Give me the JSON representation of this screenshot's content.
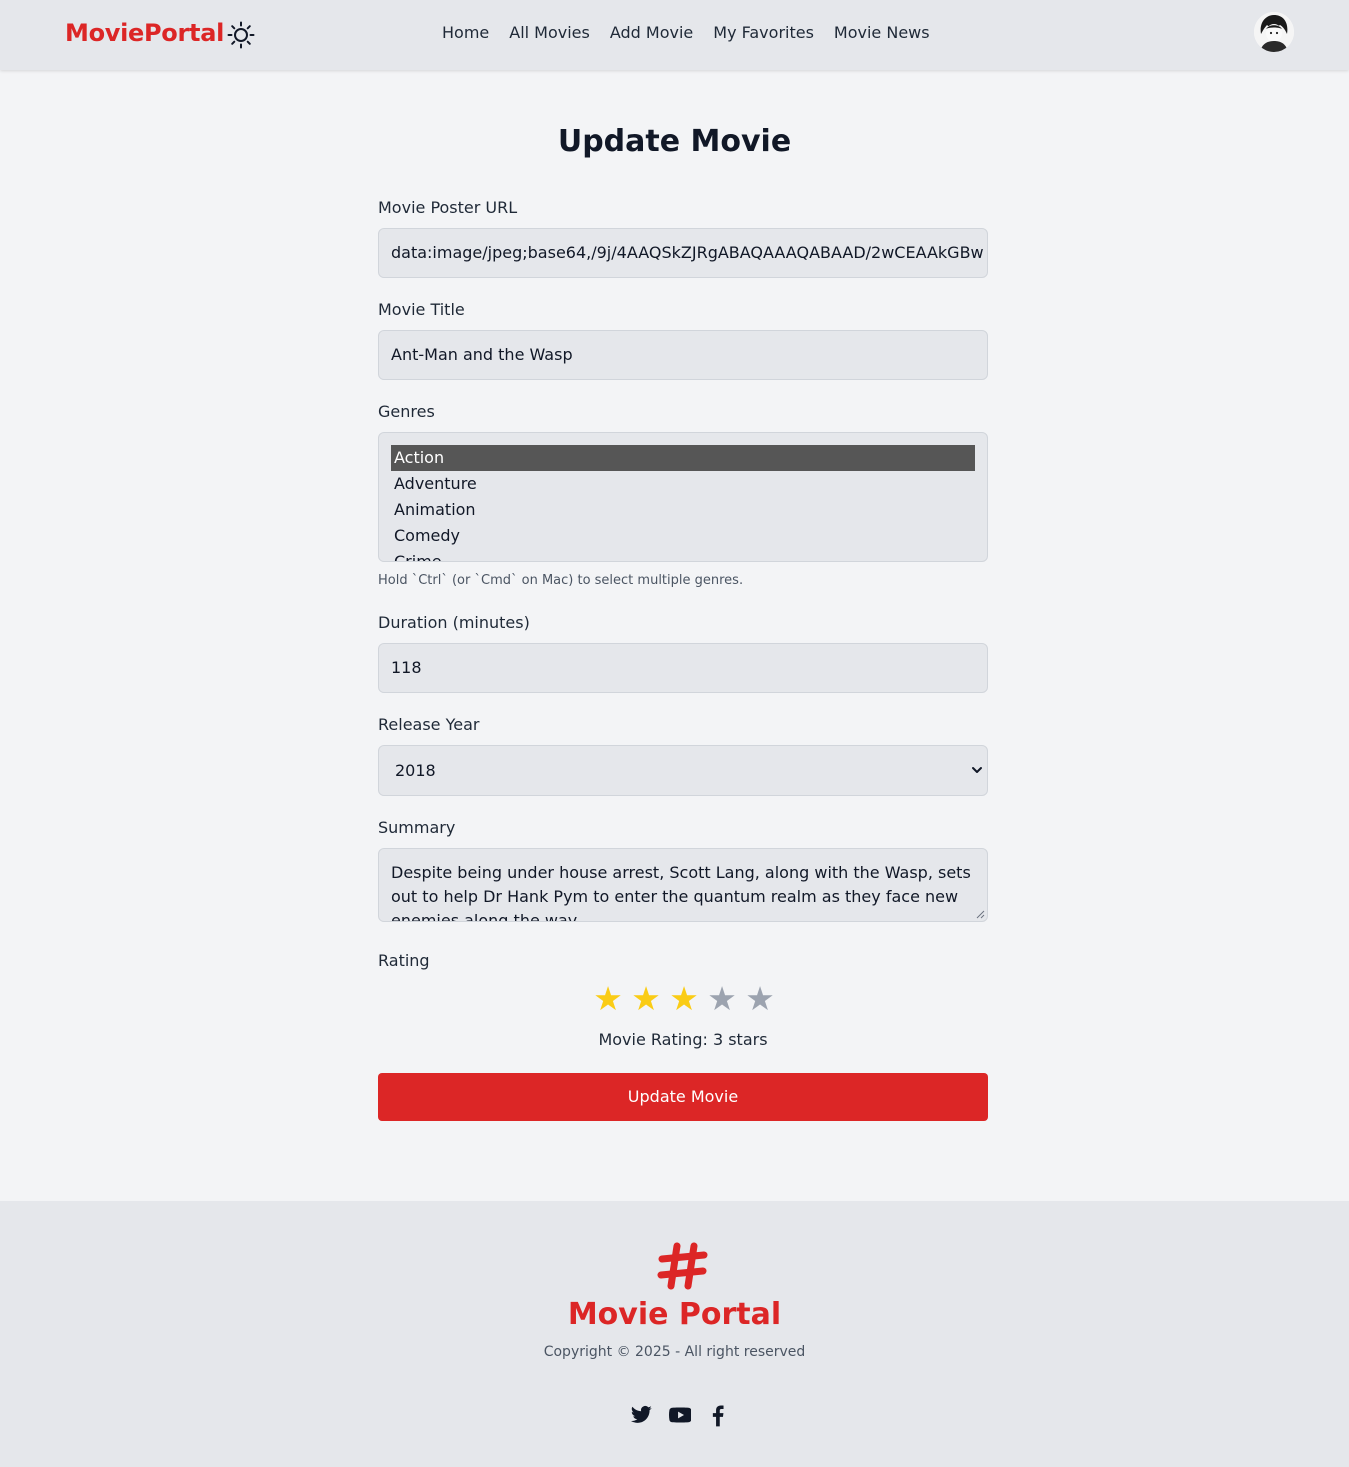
{
  "navbar": {
    "logo": "MoviePortal",
    "links": [
      "Home",
      "All Movies",
      "Add Movie",
      "My Favorites",
      "Movie News"
    ],
    "theme_icon": "sun-icon",
    "avatar_icon": "user-avatar"
  },
  "page": {
    "title": "Update Movie"
  },
  "form": {
    "poster": {
      "label": "Movie Poster URL",
      "value": "data:image/jpeg;base64,/9j/4AAQSkZJRgABAQAAAQABAAD/2wCEAAkGBw"
    },
    "title": {
      "label": "Movie Title",
      "value": "Ant-Man and the Wasp"
    },
    "genres": {
      "label": "Genres",
      "options": [
        "Action",
        "Adventure",
        "Animation",
        "Comedy",
        "Crime"
      ],
      "selected": "Action",
      "hint": "Hold `Ctrl` (or `Cmd` on Mac) to select multiple genres."
    },
    "duration": {
      "label": "Duration (minutes)",
      "value": "118"
    },
    "year": {
      "label": "Release Year",
      "value": "2018"
    },
    "summary": {
      "label": "Summary",
      "value": "Despite being under house arrest, Scott Lang, along with the Wasp, sets out to help Dr Hank Pym to enter the quantum realm as they face new enemies along the way."
    },
    "rating": {
      "label": "Rating",
      "value": 3,
      "max": 5,
      "text": "Movie Rating: 3 stars",
      "filled_color": "#facc15",
      "empty_color": "#9ca3af"
    },
    "submit_label": "Update Movie"
  },
  "footer": {
    "title": "Movie Portal",
    "copyright": "Copyright © 2025 - All right reserved",
    "logo_icon": "hashtag-logo-icon",
    "socials": [
      "twitter-icon",
      "youtube-icon",
      "facebook-icon"
    ]
  },
  "colors": {
    "brand": "#dc2626",
    "background": "#f3f4f6",
    "surface": "#e5e7eb",
    "selected_option": "#565656"
  }
}
